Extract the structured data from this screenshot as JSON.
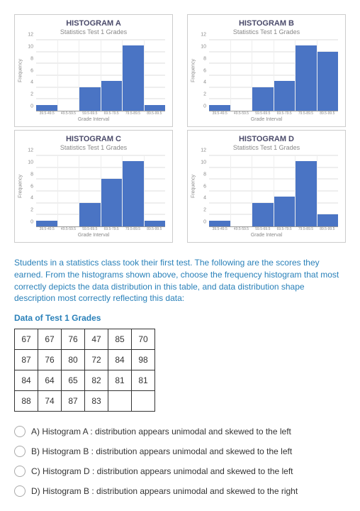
{
  "chart_data": [
    {
      "id": "A",
      "title": "HISTOGRAM A",
      "subtitle": "Statistics Test 1 Grades",
      "type": "bar",
      "xlabel": "Grade Interval",
      "ylabel": "Frequency",
      "categories": [
        "39.5-49.5",
        "49.5-59.5",
        "59.5-69.5",
        "69.5-79.5",
        "79.5-89.5",
        "89.5-99.5"
      ],
      "yticks": [
        0,
        2,
        4,
        6,
        8,
        10,
        12
      ],
      "ylim": [
        0,
        12
      ],
      "values": [
        1,
        0,
        4,
        5,
        11,
        1
      ]
    },
    {
      "id": "B",
      "title": "HISTOGRAM B",
      "subtitle": "Statistics Test 1 Grades",
      "type": "bar",
      "xlabel": "Grade Interval",
      "ylabel": "Frequency",
      "categories": [
        "39.5-49.5",
        "49.5-59.5",
        "59.5-69.5",
        "69.5-79.5",
        "79.5-89.5",
        "89.5-99.5"
      ],
      "yticks": [
        0,
        2,
        4,
        6,
        8,
        10,
        12
      ],
      "ylim": [
        0,
        12
      ],
      "values": [
        1,
        0,
        4,
        5,
        11,
        10
      ]
    },
    {
      "id": "C",
      "title": "HISTOGRAM C",
      "subtitle": "Statistics Test 1 Grades",
      "type": "bar",
      "xlabel": "Grade Interval",
      "ylabel": "Frequency",
      "categories": [
        "39.5-49.5",
        "49.5-59.5",
        "59.5-69.5",
        "69.5-79.5",
        "79.5-89.5",
        "89.5-99.5"
      ],
      "yticks": [
        0,
        2,
        4,
        6,
        8,
        10,
        12
      ],
      "ylim": [
        0,
        12
      ],
      "values": [
        1,
        0,
        4,
        8,
        11,
        1
      ]
    },
    {
      "id": "D",
      "title": "HISTOGRAM D",
      "subtitle": "Statistics Test 1 Grades",
      "type": "bar",
      "xlabel": "Grade Interval",
      "ylabel": "Frequency",
      "categories": [
        "39.5-49.5",
        "49.5-59.5",
        "59.5-69.5",
        "69.5-79.5",
        "79.5-89.5",
        "89.5-99.5"
      ],
      "yticks": [
        0,
        2,
        4,
        6,
        8,
        10,
        12
      ],
      "ylim": [
        0,
        12
      ],
      "values": [
        1,
        0,
        4,
        5,
        11,
        2
      ]
    }
  ],
  "question_text": "Students in a statistics class took their first test.  The following are the scores they earned.  From the histograms shown above, choose the frequency histogram that most correctly depicts the data distribution in this table, and data distribution shape description most correctly reflecting this data:",
  "data_table_title": "Data of Test 1 Grades",
  "data_table": [
    [
      "67",
      "67",
      "76",
      "47",
      "85",
      "70"
    ],
    [
      "87",
      "76",
      "80",
      "72",
      "84",
      "98"
    ],
    [
      "84",
      "64",
      "65",
      "82",
      "81",
      "81"
    ],
    [
      "88",
      "74",
      "87",
      "83",
      "",
      ""
    ]
  ],
  "options": {
    "a": "A) Histogram A :  distribution appears unimodal and skewed to the left",
    "b": "B) Histogram B :  distribution appears unimodal and skewed to the left",
    "c": "C) Histogram D :  distribution appears unimodal and skewed to the left",
    "d": "D) Histogram B :  distribution appears unimodal and skewed to the right"
  }
}
